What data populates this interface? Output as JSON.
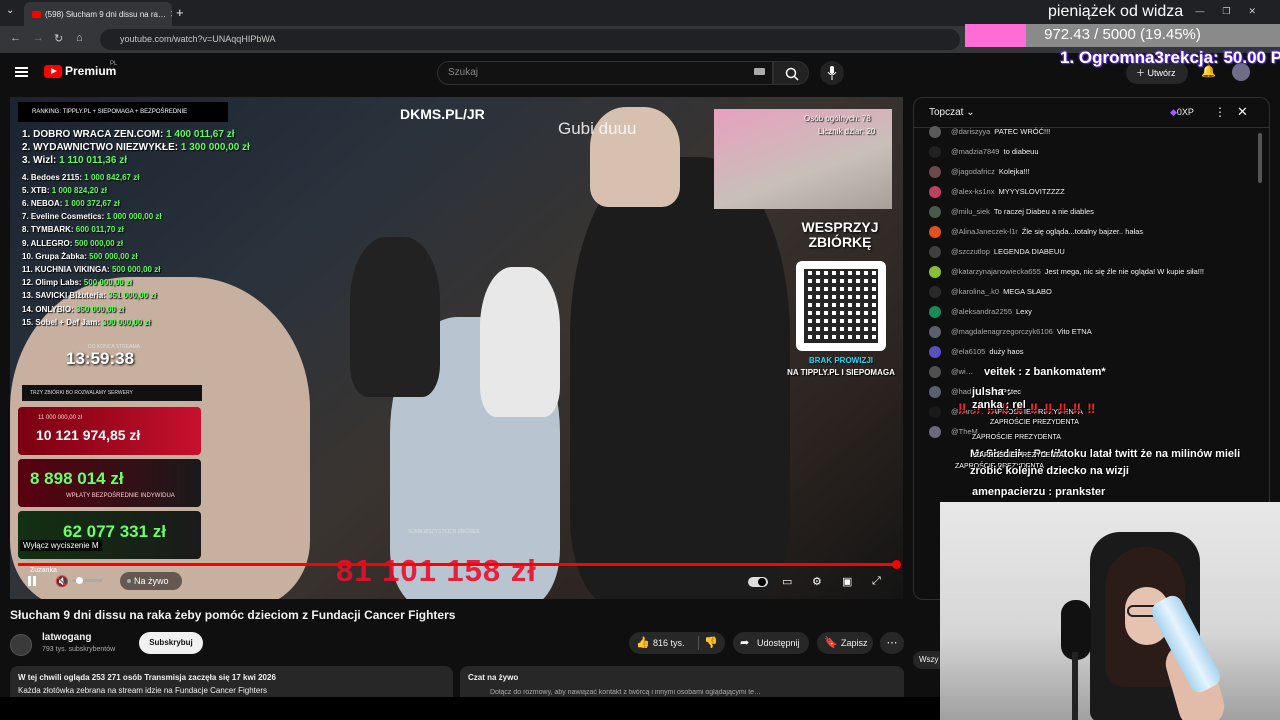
{
  "browser": {
    "tab_title": "(598) Słucham 9 dni dissu na ra…",
    "url": "youtube.com/watch?v=UNAqqHIPbWA"
  },
  "overlay": {
    "donation_title": "pieniążek od widza",
    "progress_text": "972.43 / 5000 (19.45%)",
    "progress_fraction": 0.1945,
    "progress_color": "#ff6cd6",
    "top_donor": "1. Ogromna3rekcja: 50.00 P",
    "chat_lines": [
      {
        "text": "veitek : z bankomatem*",
        "style": "normal"
      },
      {
        "text": "julsha : ",
        "style": "normal"
      },
      {
        "text": "‼ ‼ ‼ ‼ ‼ ‼ ‼ ‼ ‼ ‼",
        "style": "red"
      },
      {
        "text": "ZAPROŚCIE PREZYDENTA",
        "style": "small"
      },
      {
        "text": "ZAPROŚCIE PREZYDENTA",
        "style": "small"
      },
      {
        "text": "ZAPROŚCIE PREZYDENTA",
        "style": "small"
      },
      {
        "text": "Mr.Sledzik : Po tiktoku latał twitt że na  milinów mieli",
        "style": "normal"
      },
      {
        "text": "zrobić kolejne dziecko na wizji",
        "style": "normal"
      },
      {
        "text": "ZAPROŚCIE PREZYDENTA",
        "style": "small"
      },
      {
        "text": "amenpacierzu : prankster",
        "style": "normal"
      },
      {
        "text": "zanka : rel",
        "style": "normal"
      }
    ]
  },
  "header": {
    "brand": "Premium",
    "region": "PL",
    "search_placeholder": "Szukaj",
    "create_label": "Utwórz"
  },
  "video": {
    "watermark": "DKMS.PL/JR",
    "overlay_name": "Gubi duuu",
    "cam_stats_line1": "Osób ogólnych: 78",
    "cam_stats_line2": "Licznik dziar: 20",
    "leaderboard_header": "RANKING:   TIPPLY.PL + SIEPOMAGA + BEZPOŚREDNIE",
    "leaderboard": [
      {
        "rank": "1. DOBRO WRACA ZEN.COM:",
        "amount": "1 400 011,67 zł"
      },
      {
        "rank": "2. WYDAWNICTWO NIEZWYKŁE:",
        "amount": "1 300 000,00 zł"
      },
      {
        "rank": "3. Wizl:",
        "amount": "1 110 011,36 zł"
      },
      {
        "rank": "4. Bedoes 2115:",
        "amount": "1 000 842,67 zł"
      },
      {
        "rank": "5. XTB:",
        "amount": "1 000 824,20 zł"
      },
      {
        "rank": "6. NEBOA:",
        "amount": "1 000 372,67 zł"
      },
      {
        "rank": "7. Eveline Cosmetics:",
        "amount": "1 000 000,00 zł"
      },
      {
        "rank": "8. TYMBARK:",
        "amount": "600 011,70 zł"
      },
      {
        "rank": "9. ALLEGRO:",
        "amount": "500 000,00 zł"
      },
      {
        "rank": "10. Grupa Żabka:",
        "amount": "500 000,00 zł"
      },
      {
        "rank": "11. KUCHNIA VIKINGA:",
        "amount": "500 000,00 zł"
      },
      {
        "rank": "12. Olimp Labs:",
        "amount": "500 000,00 zł"
      },
      {
        "rank": "13. SAVICKI Biżuteria:",
        "amount": "351 000,00 zł"
      },
      {
        "rank": "14. ONLYBIO:",
        "amount": "350 000,00 zł"
      },
      {
        "rank": "15. Sobel + Def Jam:",
        "amount": "300 000,00 zł"
      }
    ],
    "countdown_label": "DO KOŃCA STREAMA",
    "countdown": "13:59:38",
    "zbiorki_header": "TRZY ZBIÓRKI BO ROZWALAMY SERWERY",
    "zbiorka1_small": "11 000 000,00 zł",
    "zbiorka1_amount": "10 121 974,85 zł",
    "zbiorka2_small": "WPŁATY BEZPOŚREDNIE INDYWIDUA",
    "zbiorka2_amount": "8 898 014 zł",
    "zbiorka3_amount": "62 077 331 zł",
    "mute_tooltip": "Wyłącz wyciszenie  M",
    "wesprzyj": "WESPRZYJ ZBIÓRKĘ",
    "brak_prowizji": "BRAK PROWIZJI",
    "brak_prowizji_2": "NA TIPPLY.PL I SIEPOMAGA",
    "suma_label": "SUMA WSZYSTKICH ZBIÓREK",
    "grand_total": "81 101 158 zł",
    "zuzanka": "Zuzanka",
    "live_label": "Na żywo"
  },
  "below_video": {
    "title": "Słucham 9 dni dissu na raka żeby pomóc dzieciom z Fundacji Cancer Fighters",
    "channel_name": "latwogang",
    "channel_subs": "793 tys. subskrybentów",
    "subscribe_label": "Subskrybuj",
    "likes": "816 tys.",
    "share_label": "Udostępnij",
    "save_label": "Zapisz",
    "desc_line1": "W tej chwili ogląda 253 271 osób  Transmisja zaczęła się 17 kwi 2026",
    "desc_line2": "Każda złotówka zebrana na stream idzie na Fundacje Cancer Fighters",
    "czat_title": "Czat na żywo",
    "czat_sub": "Dołącz do rozmowy, aby nawiązać kontakt z twórcą i innymi osobami oglądającymi te…",
    "wiszcz": "Wszy"
  },
  "chat": {
    "mode_label": "Topczat",
    "xp_label": "0XP",
    "messages": [
      {
        "author": "@dariszyya",
        "text": "PATEC WRÓĆ!!!",
        "color": "#5a5a5a"
      },
      {
        "author": "@madzia7849",
        "text": "to diabeuu",
        "color": "#222"
      },
      {
        "author": "@jagodafricz",
        "text": "Kolejka!!!",
        "color": "#6a4a4a"
      },
      {
        "author": "@alex-ks1nx",
        "text": "MYYYSLOVITZZZZ",
        "color": "#c04060"
      },
      {
        "author": "@milu_siek",
        "text": "To raczej Diabeu a nie diables",
        "color": "#4a5a4a"
      },
      {
        "author": "@AlinaJaneczek-l1r",
        "text": "Źle się ogląda...totalny bajzer.. hałas",
        "color": "#e05020"
      },
      {
        "author": "@szczutlop",
        "text": "LEGENDA DIABEUU",
        "color": "#404040"
      },
      {
        "author": "@katarzynajanowiecka655",
        "text": "Jest mega, nic się źle nie ogląda! W kupie siła!!!",
        "color": "#8ac030"
      },
      {
        "author": "@karolina_.k0",
        "text": "MEGA SŁABO",
        "color": "#2a2a2a"
      },
      {
        "author": "@aleksandra2255",
        "text": "Lexy",
        "color": "#1a8a5a"
      },
      {
        "author": "@magdalenagrzegorczyk6106",
        "text": "Vito ETNA",
        "color": "#5a6070"
      },
      {
        "author": "@ela6105",
        "text": "duży haos",
        "color": "#5a50c0"
      },
      {
        "author": "@wi…",
        "text": "",
        "color": "#505050"
      },
      {
        "author": "@had…",
        "text": "…zie Patec",
        "color": "#5a6070"
      },
      {
        "author": "@Karol…",
        "text": "ZAPROŚCIE PREZYDENTA",
        "color": "#1a1a1a"
      },
      {
        "author": "@TheM…",
        "text": "",
        "color": "#6a6a7a"
      }
    ]
  },
  "colors": {
    "yt_red": "#ff0000",
    "total_red": "#e8102e",
    "zbiorka_green": "#6bff6b"
  }
}
